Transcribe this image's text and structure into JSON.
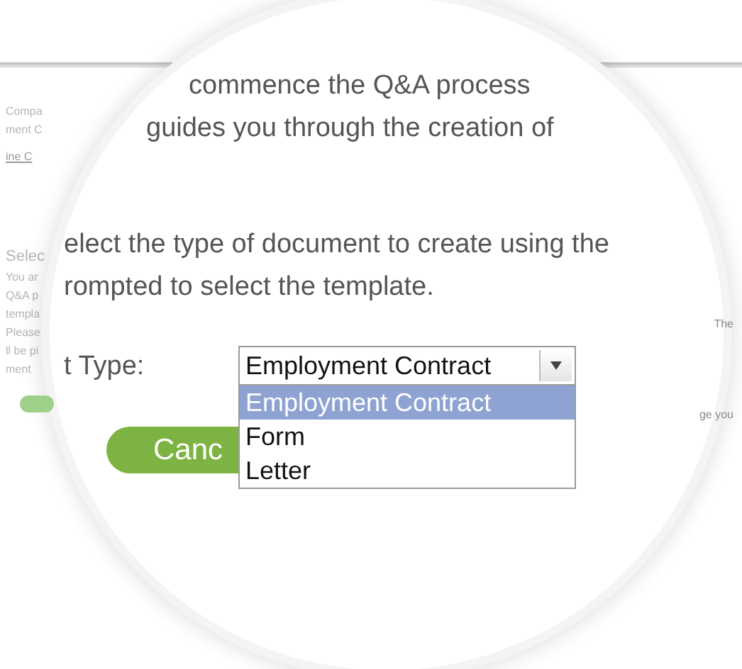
{
  "page_left": [
    {
      "kind": "text",
      "text": "Compa"
    },
    {
      "kind": "text",
      "text": "ment C"
    },
    {
      "kind": "link",
      "text": "ine C"
    },
    {
      "kind": "heading",
      "text": "Selec"
    },
    {
      "kind": "text",
      "text": "You ar"
    },
    {
      "kind": "text",
      "text": "Q&A p"
    },
    {
      "kind": "text",
      "text": "templa"
    },
    {
      "kind": "text",
      "text": "Please"
    },
    {
      "kind": "text",
      "text": "ll be pi"
    },
    {
      "kind": "text",
      "text": "ment"
    },
    {
      "kind": "toggle",
      "on": true
    }
  ],
  "page_right": [
    "The",
    "ge you"
  ],
  "lens": {
    "intro_lines": [
      "commence the Q&A process",
      "guides you through the creation of"
    ],
    "instruction_lines": [
      "elect the type of document to create using the",
      "rompted to select the template."
    ],
    "field_label": "t Type:",
    "cancel_button": "Canc",
    "select": {
      "value": "Employment Contract",
      "expanded": true,
      "options": [
        {
          "label": "Employment Contract",
          "selected": true
        },
        {
          "label": "Form",
          "selected": false
        },
        {
          "label": "Letter",
          "selected": false
        }
      ]
    }
  }
}
